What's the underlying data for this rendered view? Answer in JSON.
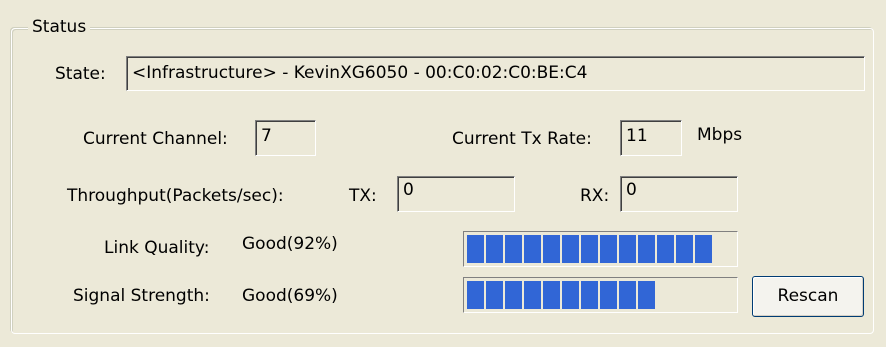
{
  "status_group": {
    "title": "Status",
    "state_label": "State:",
    "state_value": "<Infrastructure> - KevinXG6050 - 00:C0:02:C0:BE:C4",
    "channel_label": "Current Channel:",
    "channel_value": "7",
    "tx_rate_label": "Current Tx Rate:",
    "tx_rate_value": "11",
    "tx_rate_unit": "Mbps",
    "throughput_label": "Throughput(Packets/sec):",
    "tx_label": "TX:",
    "tx_value": "0",
    "rx_label": "RX:",
    "rx_value": "0",
    "link_quality_label": "Link Quality:",
    "link_quality_value": "Good(92%)",
    "link_quality_percent": 92,
    "signal_strength_label": "Signal Strength:",
    "signal_strength_value": "Good(69%)",
    "signal_strength_percent": 69,
    "rescan_label": "Rescan"
  },
  "colors": {
    "background": "#ece9d8",
    "progress_fill": "#3166d6"
  }
}
